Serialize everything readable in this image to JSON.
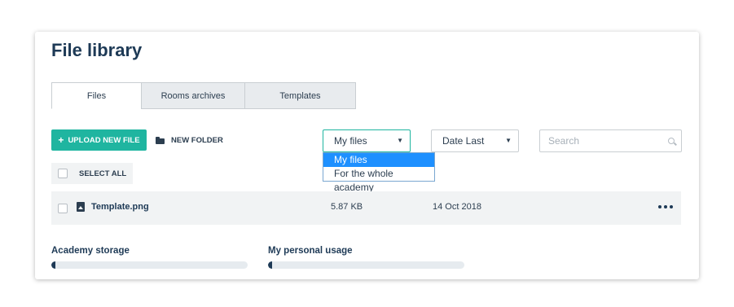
{
  "page": {
    "title": "File library"
  },
  "tabs": [
    {
      "label": "Files",
      "active": true
    },
    {
      "label": "Rooms archives",
      "active": false
    },
    {
      "label": "Templates",
      "active": false
    }
  ],
  "toolbar": {
    "upload_label": "UPLOAD NEW FILE",
    "upload_icon": "plus-icon",
    "new_folder_label": "NEW FOLDER",
    "new_folder_icon": "folder-icon"
  },
  "filters": {
    "owner": {
      "selected": "My files",
      "options": [
        "My files",
        "For the whole academy"
      ]
    },
    "sort": {
      "selected": "Date Last"
    },
    "search": {
      "placeholder": "Search",
      "icon": "search-icon"
    }
  },
  "select_all_label": "SELECT ALL",
  "files": [
    {
      "name": "Template.png",
      "icon": "image-file-icon",
      "size": "5.87 KB",
      "date": "14 Oct 2018"
    }
  ],
  "storage": {
    "academy": {
      "label": "Academy storage",
      "usage_fraction": 0.02
    },
    "personal": {
      "label": "My personal usage",
      "usage_fraction": 0.02
    }
  },
  "colors": {
    "accent": "#1fb5a0",
    "text_dark": "#1e3a56",
    "dropdown_selected": "#1e90ff"
  }
}
